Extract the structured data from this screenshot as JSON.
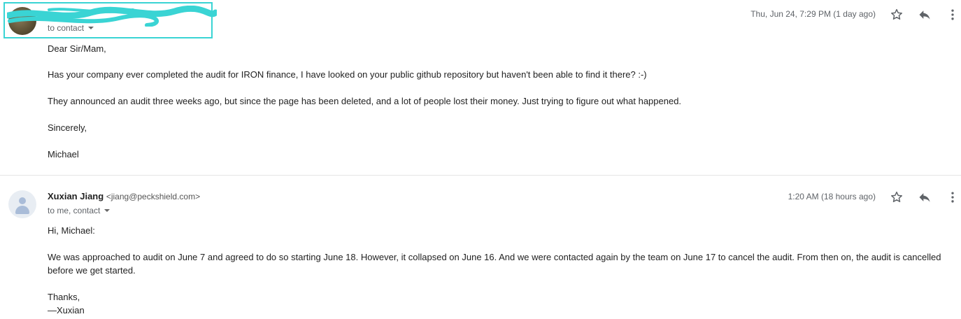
{
  "message1": {
    "to_label": "to contact",
    "timestamp": "Thu, Jun 24, 7:29 PM (1 day ago)",
    "body": {
      "greeting": "Dear Sir/Mam,",
      "para1": "Has your company ever completed the audit for IRON finance, I have looked on your public github repository but  haven't been able to find it there? :-)",
      "para2": "They announced an audit three weeks ago, but since the page has  been deleted, and a lot of people lost their money. Just trying to figure out what happened.",
      "closing": "Sincerely,",
      "signature": "Michael"
    }
  },
  "message2": {
    "sender_name": "Xuxian Jiang",
    "sender_email": "<jiang@peckshield.com>",
    "to_label": "to me, contact",
    "timestamp": "1:20 AM (18 hours ago)",
    "body": {
      "greeting": "Hi, Michael:",
      "para1": "We was approached to audit on June 7 and agreed to do so starting June 18. However, it collapsed on June 16. And we were contacted again by the team on June 17 to cancel the audit. From then on, the audit is cancelled before we get started.",
      "closing": "Thanks,",
      "signature": "—Xuxian"
    }
  },
  "icons": {
    "star": "star-icon",
    "reply": "reply-icon",
    "more": "more-vert-icon",
    "caret": "chevron-down-icon",
    "avatar": "person-icon"
  },
  "colors": {
    "redaction": "#3ad4d4",
    "icon": "#5f6368"
  }
}
